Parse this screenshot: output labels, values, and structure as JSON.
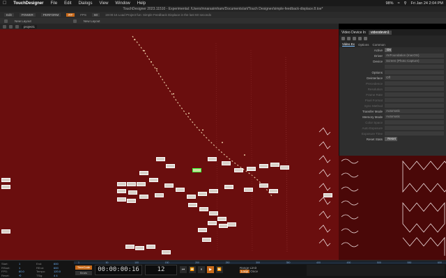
{
  "menubar": {
    "app_name": "TouchDesigner",
    "items": [
      "File",
      "Edit",
      "Dialogs",
      "View",
      "Window",
      "Help"
    ],
    "battery": "98%",
    "datetime": "Fri Jan 24  2:04 PM"
  },
  "window": {
    "title": "TouchDesigner 2023.11510 - Experimental: /Users/mnarasimham/Documents/art/Touch Designer/simple-feedback-displace.8.toe*"
  },
  "toolbar1": {
    "edit": "Edit",
    "power": "POWER",
    "pid": "PERFORM",
    "fps": "FPS",
    "fps_value": "60",
    "message": "19:00:16 Load Project   fun: Simple Feedback Displace in the last 60 seconds"
  },
  "toolbar2": {
    "new_layout_a": "New Layout",
    "new_layout_b": "New Layout"
  },
  "toolbar3": {
    "path": "project1"
  },
  "parameters": {
    "header_title": "Video Device In",
    "op_name": "videodevin1",
    "tabs": [
      "Video Ex",
      "Options",
      "Common"
    ],
    "rows": [
      {
        "label": "Active",
        "value": "On",
        "kind": "on"
      },
      {
        "label": "Driver",
        "value": "AVFoundation (macOS)",
        "kind": "val"
      },
      {
        "label": "Device",
        "value": "Screen (Photo Capture)",
        "kind": "val"
      },
      {
        "label": "",
        "value": "",
        "kind": "val"
      },
      {
        "label": "Options",
        "value": "",
        "kind": "val"
      },
      {
        "label": "Deinterlace",
        "value": "Off",
        "kind": "val"
      },
      {
        "label": "Precedence",
        "value": "",
        "kind": "dim"
      },
      {
        "label": "Resolution",
        "value": "",
        "kind": "dim"
      },
      {
        "label": "Frame Rate",
        "value": "",
        "kind": "dim"
      },
      {
        "label": "Pixel Format",
        "value": "",
        "kind": "dim"
      },
      {
        "label": "Sync Method",
        "value": "",
        "kind": "dim"
      },
      {
        "label": "Transfer Mode",
        "value": "Automatic",
        "kind": "val"
      },
      {
        "label": "Memory Mode",
        "value": "Automatic",
        "kind": "val"
      },
      {
        "label": "Color Space",
        "value": "",
        "kind": "dim"
      },
      {
        "label": "Auto Exposure",
        "value": "",
        "kind": "dim"
      },
      {
        "label": "Exposure Time",
        "value": "",
        "kind": "dim"
      },
      {
        "label": "Reset Stats",
        "value": "Reset",
        "kind": "btn"
      }
    ]
  },
  "timeline": {
    "stats": [
      {
        "k": "Start:",
        "v": "1"
      },
      {
        "k": "End:",
        "v": "600"
      },
      {
        "k": "RStart:",
        "v": "1"
      },
      {
        "k": "REnd:",
        "v": "600"
      },
      {
        "k": "FPS:",
        "v": "60.0"
      },
      {
        "k": "Tempo:",
        "v": "120.0"
      },
      {
        "k": "Reset:",
        "v": "⟲"
      },
      {
        "k": "TSig:",
        "v": "4  4"
      }
    ],
    "ruler": [
      "1",
      "50",
      "100",
      "150",
      "200",
      "250",
      "300",
      "350",
      "400",
      "450",
      "500",
      "550",
      "600"
    ],
    "timecode_label": "TimeCode",
    "beat_label": "Beats",
    "timecode": "00:00:00:16",
    "frame": "12",
    "transport": [
      "⏮",
      "⏪",
      "⏸",
      "▶",
      "⏩"
    ],
    "range_limit": "Range Limit",
    "loop": "Loop",
    "once": "Once"
  }
}
